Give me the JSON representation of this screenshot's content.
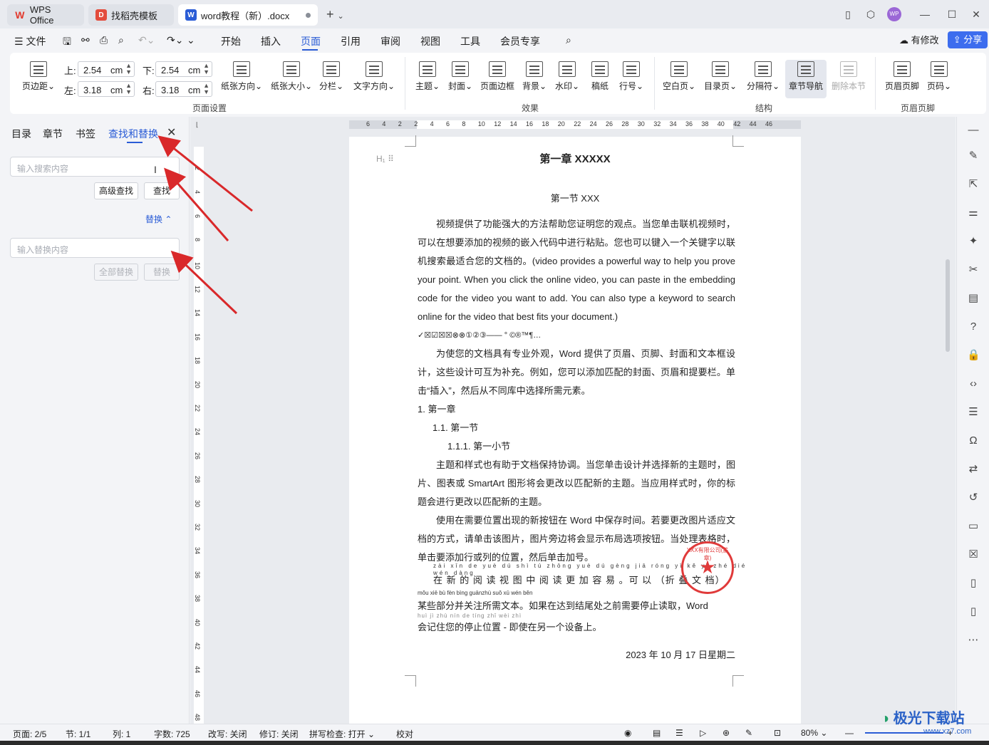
{
  "tabs": {
    "wps": "WPS Office",
    "template": "找稻壳模板",
    "doc": "word教程（新）.docx"
  },
  "menu": {
    "file": "文件",
    "items": [
      "开始",
      "插入",
      "页面",
      "引用",
      "审阅",
      "视图",
      "工具",
      "会员专享"
    ],
    "active": "页面",
    "modify": "有修改",
    "share": "分享"
  },
  "ribbon": {
    "margins_label": "页边距",
    "top_label": "上:",
    "top_value": "2.54",
    "bottom_label": "下:",
    "bottom_value": "2.54",
    "left_label": "左:",
    "left_value": "3.18",
    "right_label": "右:",
    "right_value": "3.18",
    "unit": "cm",
    "orientation": "纸张方向",
    "size": "纸张大小",
    "columns": "分栏",
    "text_direction": "文字方向",
    "theme": "主题",
    "cover": "封面",
    "page_border": "页面边框",
    "background": "背景",
    "watermark": "水印",
    "manuscript": "稿纸",
    "line_number": "行号",
    "blank_page": "空白页",
    "toc_page": "目录页",
    "separator": "分隔符",
    "section_nav": "章节导航",
    "delete_section": "删除本节",
    "header_footer": "页眉页脚",
    "page_number": "页码",
    "group_page_setup": "页面设置",
    "group_effects": "效果",
    "group_structure": "结构",
    "group_header_footer": "页眉页脚"
  },
  "pane": {
    "tabs": [
      "目录",
      "章节",
      "书签",
      "查找和替换"
    ],
    "active_tab": "查找和替换",
    "search_placeholder": "输入搜索内容",
    "advanced_find": "高级查找",
    "find": "查找",
    "replace_toggle": "替换",
    "replace_placeholder": "输入替换内容",
    "replace_all": "全部替换",
    "replace": "替换"
  },
  "hruler_ticks": [
    "6",
    "4",
    "2",
    "2",
    "4",
    "6",
    "8",
    "10",
    "12",
    "14",
    "16",
    "18",
    "20",
    "22",
    "24",
    "26",
    "28",
    "30",
    "32",
    "34",
    "36",
    "38",
    "40",
    "42",
    "44",
    "46"
  ],
  "vruler_ticks": [
    "2",
    "4",
    "6",
    "8",
    "10",
    "12",
    "14",
    "16",
    "18",
    "20",
    "22",
    "24",
    "26",
    "28",
    "30",
    "32",
    "34",
    "36",
    "38",
    "40",
    "42",
    "44",
    "46",
    "48"
  ],
  "document": {
    "h1_marker": "H₁",
    "title": "第一章  XXXXX",
    "subtitle": "第一节  XXX",
    "para1": "视频提供了功能强大的方法帮助您证明您的观点。当您单击联机视频时，可以在想要添加的视频的嵌入代码中进行粘贴。您也可以键入一个关键字以联机搜索最适合您的文档的。(video provides a powerful way to help you prove your point. When you click the online video, you can paste in the embedding code for the video you want to add. You can also type a keyword to search online for the video that best fits your document.)",
    "symbols": "✓☒☑☒☒⊗⊗①②③——   °  ©®™¶…",
    "para2": "为使您的文档具有专业外观，Word 提供了页眉、页脚、封面和文本框设计，这些设计可互为补充。例如，您可以添加匹配的封面、页眉和提要栏。单击“插入”，然后从不同库中选择所需元素。",
    "list1": "1.   第一章",
    "list2": "1.1. 第一节",
    "list3": "1.1.1.   第一小节",
    "para3": "主题和样式也有助于文档保持协调。当您单击设计并选择新的主题时，图片、图表或 SmartArt 图形将会更改以匹配新的主题。当应用样式时，你的标题会进行更改以匹配新的主题。",
    "para4": "使用在需要位置出现的新按钮在 Word 中保存时间。若要更改图片适应文档的方式，请单击该图片，图片旁边将会显示布局选项按钮。当处理表格时，单击要添加行或列的位置，然后单击加号。",
    "ruby1": "zài  xīn  de  yuè  dú  shì  tú  zhōng  yuè  dú  gèng  jiā  róng  yì       kě  yǐ       zhé  dié  wén  dàng",
    "para5a": "在 新 的 阅 读 视 图 中 阅 读 更 加 容 易 。可 以 （折 叠 文 档）",
    "ruby2": "mǒu xiē  bù fèn bìng guānzhù suǒ  xū  wén běn",
    "para5b": "某些部分并关注所需文本。如果在达到结尾处之前需要停止读取，Word",
    "ruby3": "huì  jì  zhù  nín  de  tíng zhǐ  wèi zhì",
    "para5c": "会记住您的停止位置 - 即使在另一个设备上。",
    "stamp_text": "XXX有限公司(盖章)",
    "date": "2023 年 10 月 17 日星期二"
  },
  "status": {
    "page": "页面: 2/5",
    "section": "节: 1/1",
    "column": "列: 1",
    "words": "字数: 725",
    "overtype": "改写: 关闭",
    "revision": "修订: 关闭",
    "spell": "拼写检查: 打开",
    "proofread": "校对",
    "zoom": "80%"
  },
  "watermark": {
    "brand": "极光下载站",
    "url": "www.xz7.com"
  },
  "colors": {
    "accent": "#2a5cd6",
    "share": "#3d6dee",
    "arrow": "#d9282a",
    "stamp": "#e03a3a"
  }
}
